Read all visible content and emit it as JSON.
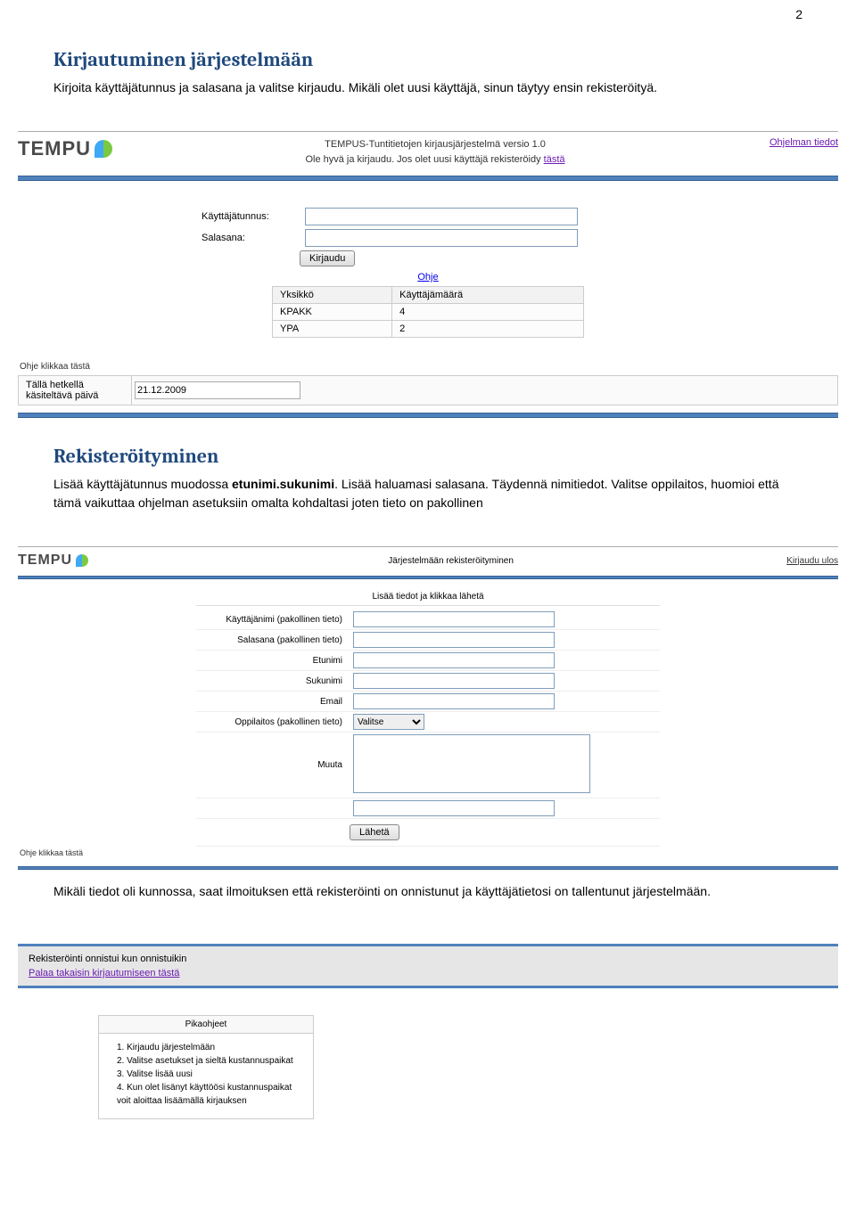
{
  "page_number": "2",
  "section1": {
    "heading": "Kirjautuminen järjestelmään",
    "paragraph": "Kirjoita käyttäjätunnus ja salasana ja valitse kirjaudu. Mikäli olet uusi käyttäjä, sinun täytyy ensin rekisteröityä."
  },
  "app1": {
    "title_line1": "TEMPUS-Tuntitietojen kirjausjärjestelmä versio 1.0",
    "title_line2_a": "Ole hyvä ja kirjaudu. Jos olet uusi käyttäjä rekisteröidy ",
    "title_line2_link": "tästä",
    "info_link": "Ohjelman tiedot",
    "logo_text": "TEMPU",
    "username_label": "Käyttäjätunnus:",
    "password_label": "Salasana:",
    "login_button": "Kirjaudu",
    "help_link": "Ohje",
    "stats_header_unit": "Yksikkö",
    "stats_header_count": "Käyttäjämäärä",
    "stats_rows": [
      {
        "unit": "KPAKK",
        "count": "4"
      },
      {
        "unit": "YPA",
        "count": "2"
      }
    ],
    "help_click": "Ohje klikkaa tästä",
    "date_label": "Tällä hetkellä käsiteltävä päivä",
    "date_value": "21.12.2009"
  },
  "section2": {
    "heading": "Rekisteröityminen",
    "paragraph": "Lisää käyttäjätunnus muodossa etunimi.sukunimi. Lisää haluamasi salasana. Täydennä nimitiedot. Valitse oppilaitos, huomioi että tämä vaikuttaa ohjelman asetuksiin omalta kohdaltasi joten tieto on pakollinen"
  },
  "app2": {
    "logo_text": "TEMPU",
    "title": "Järjestelmään rekisteröityminen",
    "logout": "Kirjaudu ulos",
    "hint": "Lisää tiedot ja klikkaa lähetä",
    "fields": {
      "username": "Käyttäjänimi (pakollinen tieto)",
      "password": "Salasana (pakollinen tieto)",
      "firstname": "Etunimi",
      "lastname": "Sukunimi",
      "email": "Email",
      "school": "Oppilaitos (pakollinen tieto)",
      "school_option": "Valitse",
      "other": "Muuta"
    },
    "submit": "Lähetä",
    "help_click": "Ohje klikkaa tästä"
  },
  "section3": {
    "paragraph": "Mikäli tiedot oli kunnossa, saat ilmoituksen että rekisteröinti on onnistunut ja käyttäjätietosi on tallentunut järjestelmään."
  },
  "app3": {
    "success_msg": "Rekisteröinti onnistui kun onnistuikin",
    "back_link": "Palaa takaisin kirjautumiseen tästä",
    "pika_title": "Pikaohjeet",
    "pika_items": [
      "1. Kirjaudu järjestelmään",
      "2. Valitse asetukset ja sieltä kustannuspaikat",
      "3. Valitse lisää uusi",
      "4. Kun olet lisänyt käyttöösi kustannuspaikat voit aloittaa lisäämällä kirjauksen"
    ]
  }
}
